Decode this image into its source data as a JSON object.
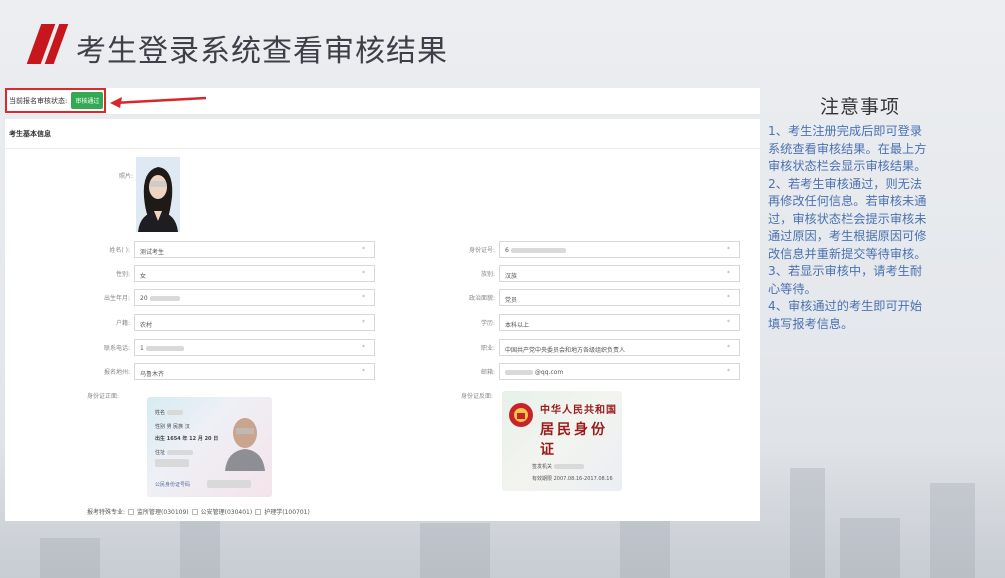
{
  "page": {
    "title": "考生登录系统查看审核结果"
  },
  "status": {
    "label": "当前报名审核状态:",
    "badge": "审核通过",
    "badge_color": "#34a853"
  },
  "section_title": "考生基本信息",
  "photo_label": "照片:",
  "left_fields": [
    {
      "label": "姓名(  ):",
      "value": "测试考生",
      "masked": false
    },
    {
      "label": "性别:",
      "value": "女",
      "masked": false
    },
    {
      "label": "出生年月:",
      "value": "20",
      "masked": true
    },
    {
      "label": "户籍:",
      "value": "农村",
      "masked": false
    },
    {
      "label": "联系电话:",
      "value": "1",
      "masked": true
    },
    {
      "label": "报名地州:",
      "value": "乌鲁木齐",
      "masked": false
    }
  ],
  "right_fields": [
    {
      "label": "身份证号:",
      "value": "6",
      "masked": true
    },
    {
      "label": "族别:",
      "value": "汉族",
      "masked": false
    },
    {
      "label": "政治面貌:",
      "value": "党员",
      "masked": false
    },
    {
      "label": "学历:",
      "value": "本科以上",
      "masked": false
    },
    {
      "label": "职业:",
      "value": "中国共产党中央委员会和地方各级组织负责人",
      "masked": false
    },
    {
      "label": "邮箱:",
      "value": "@qq.com",
      "masked": true
    }
  ],
  "field_caret": "*",
  "id_front_label": "身份证正面:",
  "id_back_label": "身份证反面:",
  "id_front": {
    "line2": "性别 男 民族 汉",
    "line3": "出生 1654 年 12 月 20 日",
    "footer": "公民身份证号码"
  },
  "id_back": {
    "country": "中华人民共和国",
    "card_name": "居民身份证",
    "authority": "签发机关",
    "validity": "有效期限 2007.08.16-2017.08.16"
  },
  "majors": {
    "label": "报考特殊专业:",
    "options": [
      "监所管理(030109)",
      "公安管理(030401)",
      "护理学(100701)"
    ]
  },
  "notes": {
    "title": "注意事项",
    "items": [
      "1、考生注册完成后即可登录系统查看审核结果。在最上方审核状态栏会显示审核结果。",
      "2、若考生审核通过，则无法再修改任何信息。若审核未通过，审核状态栏会提示审核未通过原因，考生根据原因可修改信息并重新提交等待审核。",
      "3、若显示审核中，请考生耐心等待。",
      "4、审核通过的考生即可开始填写报考信息。"
    ]
  },
  "colors": {
    "accent_red": "#c8161d",
    "note_text": "#4a72b0"
  }
}
